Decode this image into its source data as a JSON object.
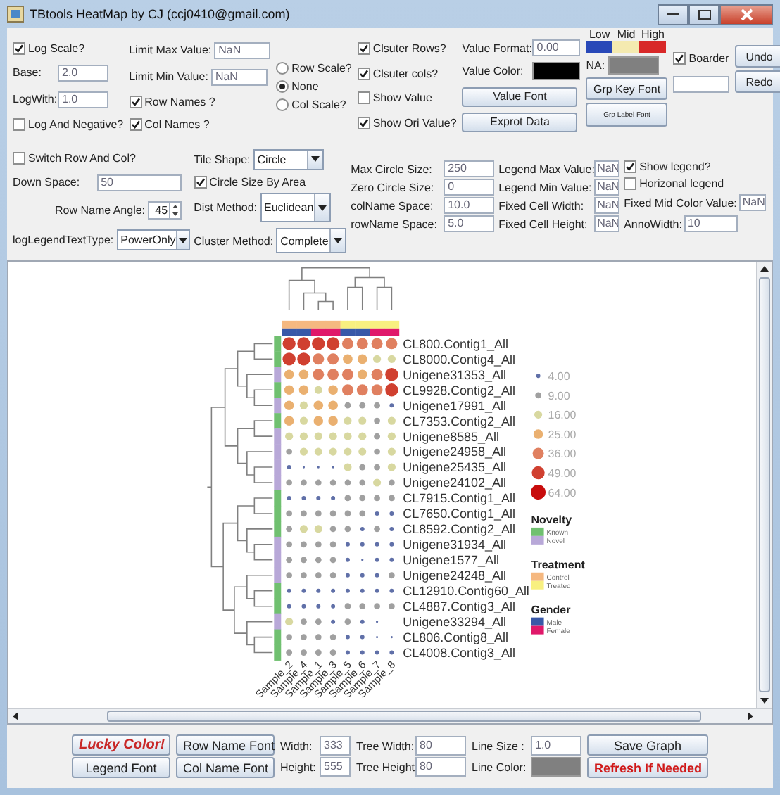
{
  "window": {
    "title": "TBtools HeatMap by CJ (ccj0410@gmail.com)"
  },
  "options_top": [
    [
      {
        "kind": "check",
        "label": "Log Scale?",
        "checked": true
      },
      {
        "kind": "field",
        "label": "Base:",
        "value": "2.0"
      },
      {
        "kind": "field",
        "label": "LogWith:",
        "value": "1.0"
      },
      {
        "kind": "check",
        "label": "Log And Negative?",
        "checked": false
      }
    ],
    [
      {
        "kind": "field",
        "label": "Limit Max Value:",
        "value": "NaN"
      },
      {
        "kind": "field",
        "label": "Limit Min Value:",
        "value": "NaN"
      },
      {
        "kind": "check",
        "label": "Row Names ?",
        "checked": true
      },
      {
        "kind": "check",
        "label": "Col Names ?",
        "checked": true
      }
    ],
    [
      {
        "kind": "radio",
        "label": "Row Scale?",
        "selected": false
      },
      {
        "kind": "radio",
        "label": "None",
        "selected": true
      },
      {
        "kind": "radio",
        "label": "Col Scale?",
        "selected": false
      }
    ],
    [
      {
        "kind": "check",
        "label": "Clsuter Rows?",
        "checked": true
      },
      {
        "kind": "check",
        "label": "Clsuter cols?",
        "checked": true
      },
      {
        "kind": "check",
        "label": "Show Value",
        "checked": false
      },
      {
        "kind": "check",
        "label": "Show Ori Value?",
        "checked": true
      }
    ],
    [
      {
        "kind": "field",
        "label": "Value Format:",
        "value": "0.00"
      },
      {
        "kind": "swatch",
        "label": "Value Color:",
        "color": "#000000"
      },
      {
        "kind": "button",
        "label": "Value Font"
      },
      {
        "kind": "button",
        "label": "Exprot Data"
      }
    ],
    [
      {
        "kind": "scale",
        "stops": [
          {
            "label": "Low",
            "color": "#2848b8"
          },
          {
            "label": "Mid",
            "color": "#f4eab0"
          },
          {
            "label": "High",
            "color": "#d82828"
          }
        ]
      },
      {
        "kind": "swatch",
        "label": "NA:",
        "color": "#808080"
      },
      {
        "kind": "button",
        "label": "Grp Key Font"
      },
      {
        "kind": "small",
        "label": "Grp Label Font"
      }
    ],
    [
      {
        "kind": "check",
        "label": "Boarder",
        "checked": true
      },
      {
        "kind": "field"
      }
    ],
    [
      {
        "kind": "button",
        "label": "Undo"
      },
      {
        "kind": "button",
        "label": "Redo"
      }
    ]
  ],
  "options_mid": [
    [
      {
        "kind": "check",
        "label": "Switch Row And Col?",
        "checked": false
      },
      {
        "kind": "field",
        "label": "Down Space:",
        "value": "50"
      },
      {
        "kind": "spinner",
        "label": "Row Name Angle:",
        "value": "45"
      },
      {
        "kind": "combo",
        "label": "logLegendTextType:",
        "value": "PowerOnly"
      }
    ],
    [
      {
        "kind": "combo",
        "label": "Tile Shape:",
        "value": "Circle"
      },
      {
        "kind": "check",
        "label": "Circle Size By Area",
        "checked": true
      },
      {
        "kind": "combo",
        "label": "Dist Method:",
        "value": "Euclidean"
      },
      {
        "kind": "combo",
        "label": "Cluster Method:",
        "value": "Complete"
      }
    ],
    [
      {
        "kind": "field",
        "label": "Max Circle Size:",
        "value": "250"
      },
      {
        "kind": "field",
        "label": "Zero Circle Size:",
        "value": "0"
      },
      {
        "kind": "field",
        "label": "colName Space:",
        "value": "10.0"
      },
      {
        "kind": "field",
        "label": "rowName Space:",
        "value": "5.0"
      }
    ],
    [
      {
        "kind": "field",
        "label": "Legend Max Value:",
        "value": "NaN"
      },
      {
        "kind": "field",
        "label": "Legend Min Value:",
        "value": "NaN"
      },
      {
        "kind": "field",
        "label": "Fixed Cell Width:",
        "value": "NaN"
      },
      {
        "kind": "field",
        "label": "Fixed Cell Height:",
        "value": "NaN"
      }
    ],
    [
      {
        "kind": "check",
        "label": "Show legend?",
        "checked": true
      },
      {
        "kind": "check",
        "label": "Horizonal legend",
        "checked": false
      },
      {
        "kind": "field",
        "label": "Fixed Mid Color Value:",
        "value": "NaN"
      },
      {
        "kind": "field",
        "label": "AnnoWidth:",
        "value": "10"
      }
    ]
  ],
  "heatmap": {
    "columns": [
      {
        "label": "Sample_2",
        "annotations": [
          {
            "color": "#f5b880"
          },
          {
            "color": "#3858a8"
          }
        ]
      },
      {
        "label": "Sample_4",
        "annotations": [
          {
            "color": "#f5b880"
          },
          {
            "color": "#3858a8"
          }
        ]
      },
      {
        "label": "Sample_1",
        "annotations": [
          {
            "color": "#f5b880"
          },
          {
            "color": "#e0186a"
          }
        ]
      },
      {
        "label": "Sample_3",
        "annotations": [
          {
            "color": "#f5b880"
          },
          {
            "color": "#e0186a"
          }
        ]
      },
      {
        "label": "Sample_5",
        "annotations": [
          {
            "color": "#f8f080"
          },
          {
            "color": "#3858a8"
          }
        ]
      },
      {
        "label": "Sample_6",
        "annotations": [
          {
            "color": "#f8f080"
          },
          {
            "color": "#3858a8"
          }
        ]
      },
      {
        "label": "Sample_7",
        "annotations": [
          {
            "color": "#f8f080"
          },
          {
            "color": "#e0186a"
          }
        ]
      },
      {
        "label": "Sample_8",
        "annotations": [
          {
            "color": "#f8f080"
          },
          {
            "color": "#e0186a"
          }
        ]
      }
    ],
    "rows": [
      {
        "name": "CL800.Contig1_All",
        "color": "#70c070"
      },
      {
        "name": "CL8000.Contig4_All",
        "color": "#70c070"
      },
      {
        "name": "Unigene31353_All",
        "color": "#b8a8d8"
      },
      {
        "name": "CL9928.Contig2_All",
        "color": "#70c070"
      },
      {
        "name": "Unigene17991_All",
        "color": "#b8a8d8"
      },
      {
        "name": "CL7353.Contig2_All",
        "color": "#70c070"
      },
      {
        "name": "Unigene8585_All",
        "color": "#b8a8d8"
      },
      {
        "name": "Unigene24958_All",
        "color": "#b8a8d8"
      },
      {
        "name": "Unigene25435_All",
        "color": "#b8a8d8"
      },
      {
        "name": "Unigene24102_All",
        "color": "#b8a8d8"
      },
      {
        "name": "CL7915.Contig1_All",
        "color": "#70c070"
      },
      {
        "name": "CL7650.Contig1_All",
        "color": "#70c070"
      },
      {
        "name": "CL8592.Contig2_All",
        "color": "#70c070"
      },
      {
        "name": "Unigene31934_All",
        "color": "#b8a8d8"
      },
      {
        "name": "Unigene1577_All",
        "color": "#b8a8d8"
      },
      {
        "name": "Unigene24248_All",
        "color": "#b8a8d8"
      },
      {
        "name": "CL12910.Contig60_All",
        "color": "#70c070"
      },
      {
        "name": "CL4887.Contig3_All",
        "color": "#70c070"
      },
      {
        "name": "Unigene33294_All",
        "color": "#b8a8d8"
      },
      {
        "name": "CL806.Contig8_All",
        "color": "#70c070"
      },
      {
        "name": "CL4008.Contig3_All",
        "color": "#70c070"
      }
    ],
    "size_legend": [
      {
        "label": "4.00",
        "color": "#6070a8"
      },
      {
        "label": "9.00",
        "color": "#a0a0a0"
      },
      {
        "label": "16.00",
        "color": "#d8d8a0"
      },
      {
        "label": "25.00",
        "color": "#eab070"
      },
      {
        "label": "36.00",
        "color": "#e08060"
      },
      {
        "label": "49.00",
        "color": "#d04030"
      },
      {
        "label": "64.00",
        "color": "#c80c0c"
      }
    ],
    "groups": [
      {
        "title": "Novelty",
        "items": [
          {
            "label": "Known",
            "color": "#70c070"
          },
          {
            "label": "Novel",
            "color": "#b8a8d8"
          }
        ]
      },
      {
        "title": "Treatment",
        "items": [
          {
            "label": "Control",
            "color": "#f5b880"
          },
          {
            "label": "Treated",
            "color": "#f8f080"
          }
        ]
      },
      {
        "title": "Gender",
        "items": [
          {
            "label": "Male",
            "color": "#3858a8"
          },
          {
            "label": "Female",
            "color": "#e0186a"
          }
        ]
      }
    ]
  },
  "options_bottom": [
    [
      {
        "kind": "lucky",
        "label": "Lucky Color!"
      },
      {
        "kind": "button",
        "label": "Legend Font"
      }
    ],
    [
      {
        "kind": "button",
        "label": "Row Name Font"
      },
      {
        "kind": "button",
        "label": "Col Name Font"
      }
    ],
    [
      {
        "kind": "field",
        "label": "Width:",
        "value": "333"
      },
      {
        "kind": "field",
        "label": "Height:",
        "value": "555"
      }
    ],
    [
      {
        "kind": "field",
        "label": "Tree Width:",
        "value": "80"
      },
      {
        "kind": "field",
        "label": "Tree Height:",
        "value": "80"
      }
    ],
    [
      {
        "kind": "field",
        "label": "Line Size :",
        "value": "1.0"
      },
      {
        "kind": "swatch",
        "label": "Line Color:",
        "color": "#808080"
      }
    ],
    [
      {
        "kind": "button",
        "label": "Save Graph"
      },
      {
        "kind": "warning",
        "label": "Refresh If Needed"
      }
    ]
  ]
}
